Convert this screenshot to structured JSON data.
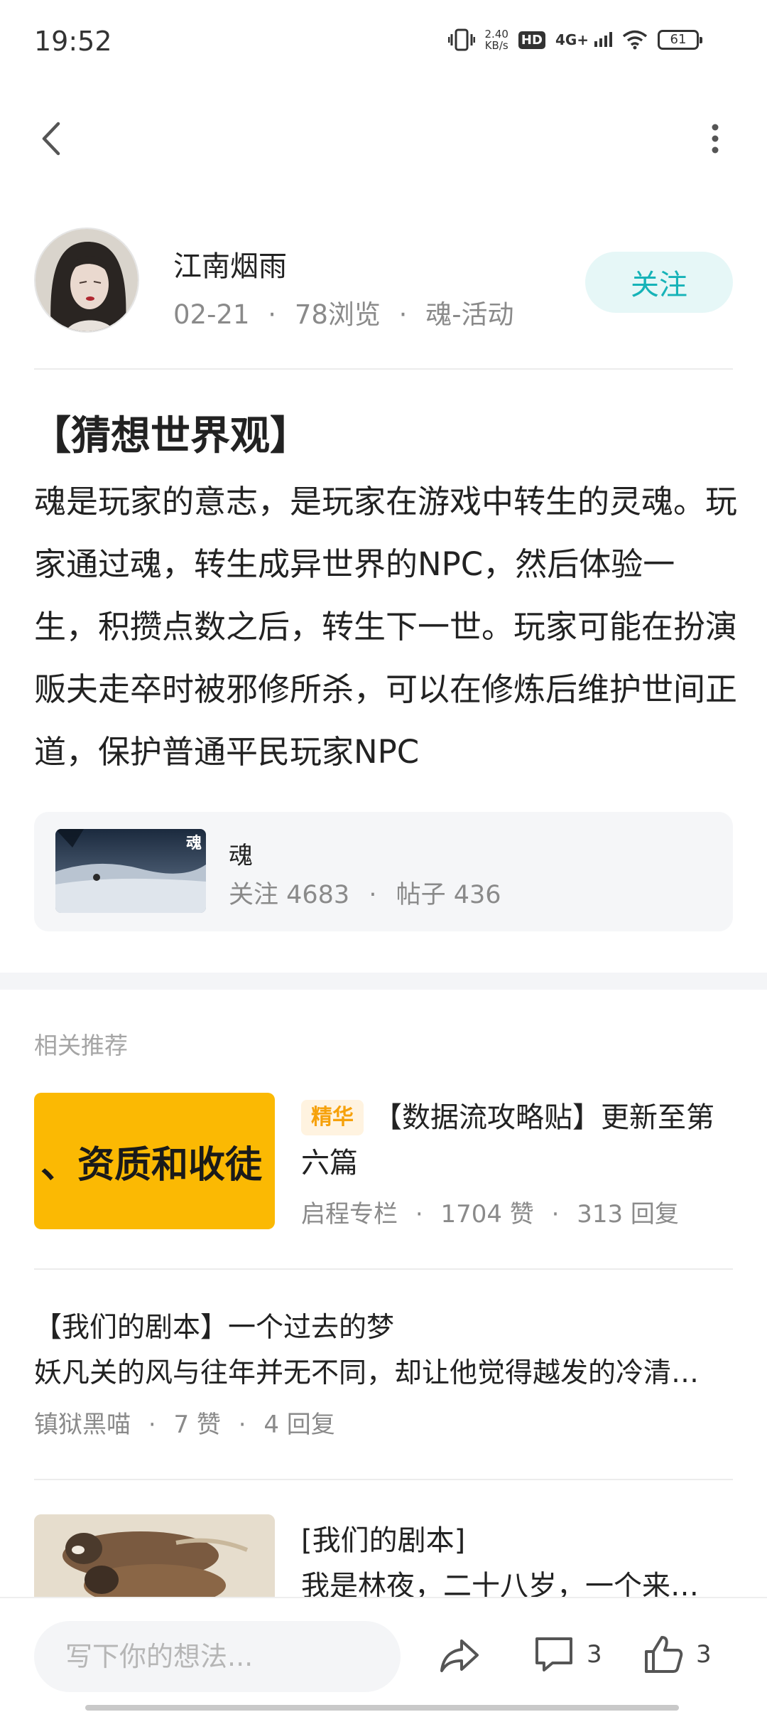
{
  "status_bar": {
    "time": "19:52",
    "net_speed_value": "2.40",
    "net_speed_unit": "KB/s",
    "hd": "HD",
    "network": "4G+",
    "battery": "61",
    "battery_level": 0.61,
    "icons": [
      "vibrate-icon",
      "hd-icon",
      "signal-icon",
      "wifi-icon",
      "battery-icon"
    ]
  },
  "nav": {
    "back_icon": "chevron-left-icon",
    "more_icon": "more-vertical-icon"
  },
  "author": {
    "name": "江南烟雨",
    "date": "02-21",
    "views": "78浏览",
    "board": "魂-活动",
    "sep": "·",
    "follow_label": "关注"
  },
  "post": {
    "title": "【猜想世界观】",
    "body": "魂是玩家的意志，是玩家在游戏中转生的灵魂。玩家通过魂，转生成异世界的NPC，然后体验一生，积攒点数之后，转生下一世。玩家可能在扮演贩夫走卒时被邪修所杀，可以在修炼后维护世间正道，保护普通平民玩家NPC"
  },
  "topic": {
    "name": "魂",
    "followers_label": "关注 4683",
    "posts_label": "帖子 436",
    "sep": "·",
    "thumb_logo": "魂"
  },
  "related": {
    "section_title": "相关推荐",
    "items": [
      {
        "thumb_text": "、资质和收徒",
        "tag": "精华",
        "title": "【数据流攻略贴】更新至第六篇",
        "author": "启程专栏",
        "likes": "1704 赞",
        "replies": "313 回复",
        "sep": "·"
      },
      {
        "title": "【我们的剧本】一个过去的梦",
        "summary": "妖凡关的风与往年并无不同，却让他觉得越发的冷清寂寥",
        "author": "镇狱黑喵",
        "likes": "7 赞",
        "replies": "4 回复",
        "sep": "·"
      },
      {
        "title": "[我们的剧本]",
        "summary": "我是林夜，二十八岁，一个来自现代都市的普通人"
      }
    ]
  },
  "bottom_bar": {
    "input_placeholder": "写下你的想法...",
    "share_icon": "share-icon",
    "comment_icon": "comment-icon",
    "comment_count": "3",
    "like_icon": "thumbs-up-icon",
    "like_count": "3"
  },
  "colors": {
    "accent": "#16b3b8",
    "follow_bg": "#e6f7f7",
    "tag_orange": "#f6a10a",
    "thumb_yellow": "#fbb903",
    "muted_text": "#8a8a8a"
  }
}
